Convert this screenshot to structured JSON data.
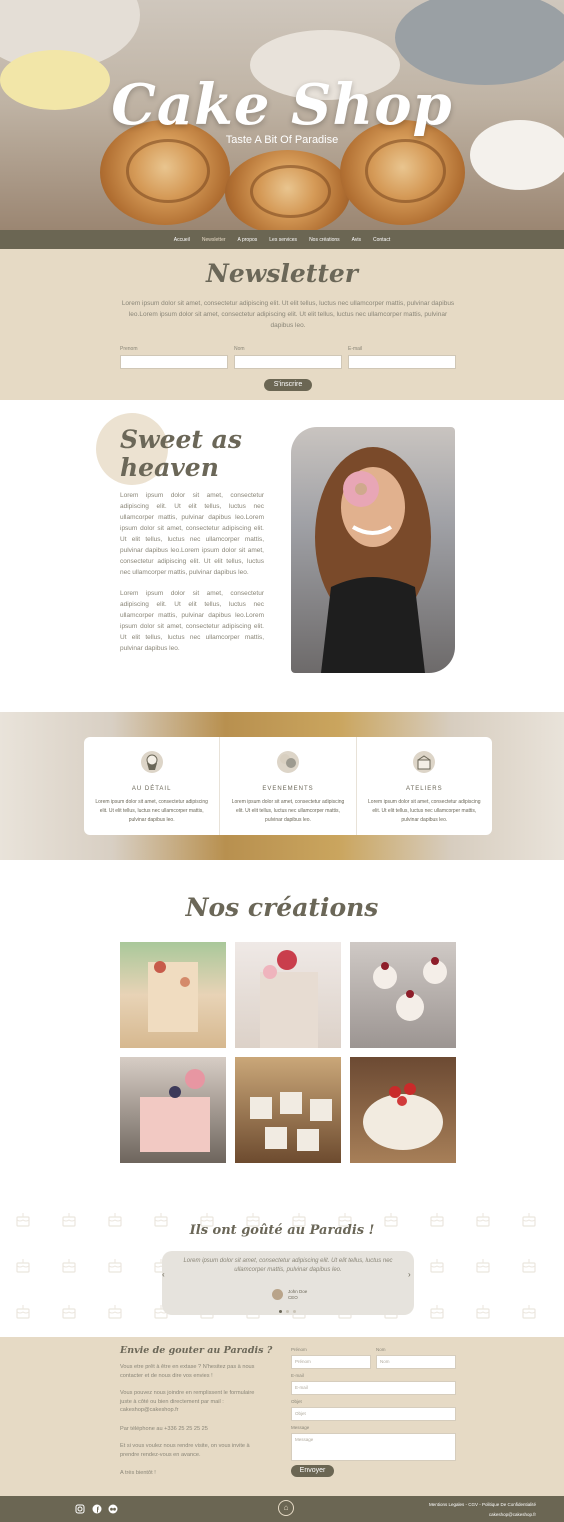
{
  "hero": {
    "title": "Cake Shop",
    "subtitle": "Taste A Bit Of Paradise"
  },
  "nav": {
    "items": [
      "Accueil",
      "Newsletter",
      "A propos",
      "Les services",
      "Nos créations",
      "Avis",
      "Contact"
    ]
  },
  "newsletter": {
    "title": "Newsletter",
    "text": "Lorem ipsum dolor sit amet, consectetur adipiscing elit. Ut elit tellus, luctus nec ullamcorper mattis, pulvinar dapibus leo.Lorem ipsum dolor sit amet, consectetur adipiscing elit. Ut elit tellus, luctus nec ullamcorper mattis, pulvinar dapibus leo.",
    "fields": [
      "Prenom",
      "Nom",
      "E-mail"
    ],
    "button": "S'inscrire"
  },
  "about": {
    "title_line1": "Sweet as",
    "title_line2": "heaven",
    "p1": "Lorem ipsum dolor sit amet, consectetur adipiscing elit. Ut elit tellus, luctus nec ullamcorper mattis, pulvinar dapibus leo.Lorem ipsum dolor sit amet, consectetur adipiscing elit. Ut elit tellus, luctus nec ullamcorper mattis, pulvinar dapibus leo.Lorem ipsum dolor sit amet, consectetur adipiscing elit. Ut elit tellus, luctus nec ullamcorper mattis, pulvinar dapibus leo.",
    "p2": "Lorem ipsum dolor sit amet, consectetur adipiscing elit. Ut elit tellus, luctus nec ullamcorper mattis, pulvinar dapibus leo.Lorem ipsum dolor sit amet, consectetur adipiscing elit. Ut elit tellus, luctus nec ullamcorper mattis, pulvinar dapibus leo."
  },
  "services": [
    {
      "title": "AU DÉTAIL",
      "text": "Lorem ipsum dolor sit amet, consectetur adipiscing elit. Ut elit tellus, luctus nec ullamcorper mattis, pulvinar dapibus leo.",
      "icon": "cupcake-icon"
    },
    {
      "title": "EVENEMENTS",
      "text": "Lorem ipsum dolor sit amet, consectetur adipiscing elit. Ut elit tellus, luctus nec ullamcorper mattis, pulvinar dapibus leo.",
      "icon": "balloons-icon"
    },
    {
      "title": "ATELIERS",
      "text": "Lorem ipsum dolor sit amet, consectetur adipiscing elit. Ut elit tellus, luctus nec ullamcorper mattis, pulvinar dapibus leo.",
      "icon": "cake-box-icon"
    }
  ],
  "creations": {
    "title": "Nos créations"
  },
  "testimonials": {
    "title": "Ils ont goûté au Paradis !",
    "quote": "Lorem ipsum dolor sit amet, consectetur adipiscing elit. Ut elit tellus, luctus nec ullamcorper mattis, pulvinar dapibus leo.",
    "name": "John Doe",
    "role": "CEO"
  },
  "contact": {
    "title": "Envie de gouter au Paradis ?",
    "p1": "Vous etre prêt à être en extase ? N'hesitez pas à nous contacter et de nous dire vos envies !",
    "p2": "Vous pouvez nous joindre en remplissent le formulaire juste à côté ou bien directement par mail : cakeshop@cakeshop.fr",
    "p3": "Par téléphone au +336 25 25 25 25",
    "p4": "Et si vous voulez nous rendre visite, on vous invite à prendre rendez-vous en avance.",
    "p5": "A très bientôt !",
    "labels": {
      "prenom": "Prénom",
      "nom": "Nom",
      "email": "E-mail",
      "objet": "Objet",
      "message": "Message"
    },
    "placeholders": {
      "prenom": "Prénom",
      "nom": "Nom",
      "email": "E-mail",
      "objet": "Objet",
      "message": "Message"
    },
    "button": "Envoyer"
  },
  "footer": {
    "links": "Mentions Legales - CGV - Politique De Confidentialité",
    "email": "cakeshop@cakeshop.fr"
  }
}
